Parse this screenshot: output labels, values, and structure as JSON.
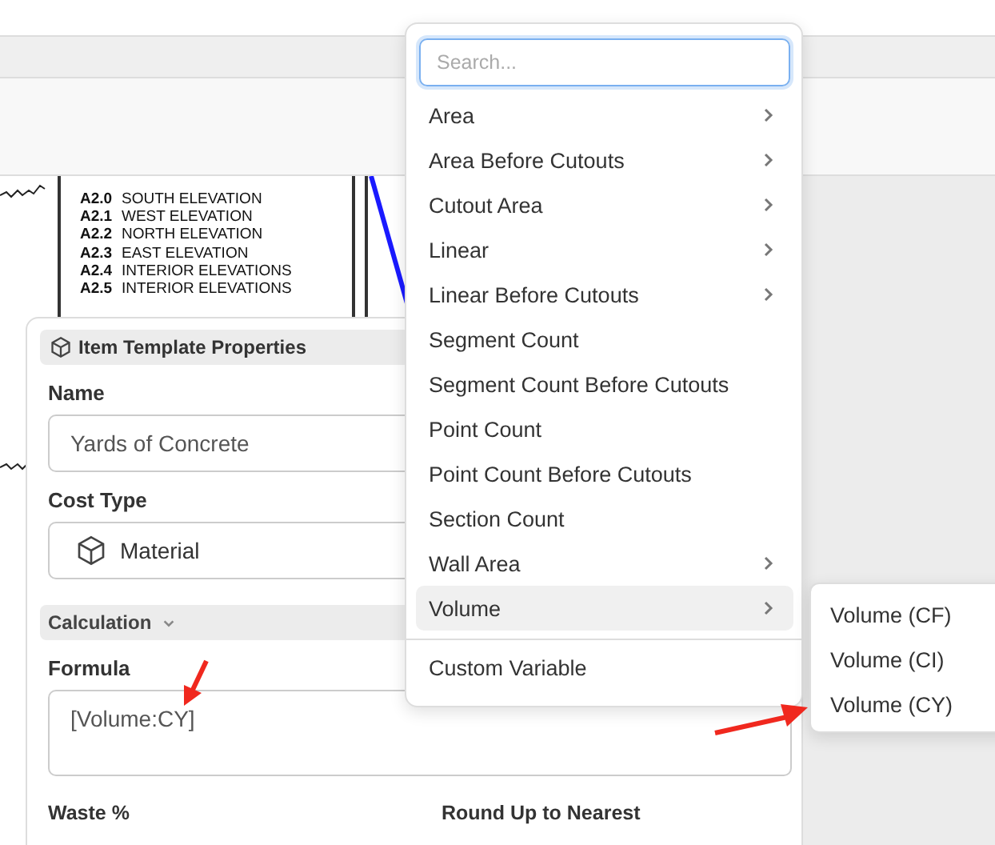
{
  "drawing_sheet": {
    "index": [
      {
        "code": "A2.0",
        "title": "SOUTH ELEVATION"
      },
      {
        "code": "A2.1",
        "title": "WEST ELEVATION"
      },
      {
        "code": "A2.2",
        "title": "NORTH ELEVATION"
      },
      {
        "code": "A2.3",
        "title": "EAST ELEVATION"
      },
      {
        "code": "A2.4",
        "title": "INTERIOR ELEVATIONS"
      },
      {
        "code": "A2.5",
        "title": "INTERIOR ELEVATIONS"
      }
    ]
  },
  "properties_panel": {
    "title": "Item Template Properties",
    "name_label": "Name",
    "name_value": "Yards of Concrete",
    "cost_type_label": "Cost Type",
    "cost_type_value": "Material",
    "calculation": {
      "label": "Calculation",
      "expanded": true
    },
    "formula_label": "Formula",
    "formula_value": "[Volume:CY]",
    "waste_label": "Waste %",
    "round_label": "Round Up to Nearest"
  },
  "variable_menu": {
    "search_placeholder": "Search...",
    "items": [
      {
        "label": "Area",
        "has_submenu": true,
        "selected": false
      },
      {
        "label": "Area Before Cutouts",
        "has_submenu": true,
        "selected": false
      },
      {
        "label": "Cutout Area",
        "has_submenu": true,
        "selected": false
      },
      {
        "label": "Linear",
        "has_submenu": true,
        "selected": false
      },
      {
        "label": "Linear Before Cutouts",
        "has_submenu": true,
        "selected": false
      },
      {
        "label": "Segment Count",
        "has_submenu": false,
        "selected": false
      },
      {
        "label": "Segment Count Before Cutouts",
        "has_submenu": false,
        "selected": false
      },
      {
        "label": "Point Count",
        "has_submenu": false,
        "selected": false
      },
      {
        "label": "Point Count Before Cutouts",
        "has_submenu": false,
        "selected": false
      },
      {
        "label": "Section Count",
        "has_submenu": false,
        "selected": false
      },
      {
        "label": "Wall Area",
        "has_submenu": true,
        "selected": false
      },
      {
        "label": "Volume",
        "has_submenu": true,
        "selected": true
      }
    ],
    "footer_item": "Custom Variable"
  },
  "submenu": {
    "items": [
      "Volume (CF)",
      "Volume (CI)",
      "Volume (CY)"
    ]
  }
}
